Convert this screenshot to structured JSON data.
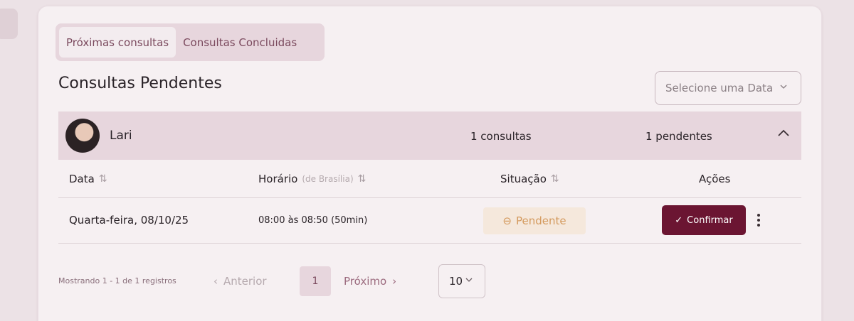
{
  "tabs": [
    {
      "label": "Próximas consultas",
      "active": true
    },
    {
      "label": "Consultas Concluidas",
      "active": false
    }
  ],
  "heading": "Consultas Pendentes",
  "date_select": {
    "placeholder": "Selecione uma Data",
    "icon": "chevron-down-icon"
  },
  "patient": {
    "name": "Lari",
    "consultas": "1 consultas",
    "pendentes": "1 pendentes",
    "collapse_icon": "chevron-up-icon"
  },
  "table": {
    "headers": {
      "data": "Data",
      "horario": "Horário",
      "horario_sub": "(de Brasília)",
      "situacao": "Situação",
      "acoes": "Ações"
    },
    "rows": [
      {
        "data": "Quarta-feira, 08/10/25",
        "horario": "08:00 às 08:50 (50min)",
        "status": "Pendente",
        "confirm_label": "Confirmar"
      }
    ]
  },
  "pagination": {
    "info": "Mostrando 1 - 1 de 1 registros",
    "prev": "Anterior",
    "page": "1",
    "next": "Próximo",
    "page_size": "10"
  },
  "colors": {
    "accent": "#6b1532",
    "tab_bg": "#e7d6dd",
    "status_bg": "#f5e8dc",
    "status_text": "#d49a5e"
  }
}
